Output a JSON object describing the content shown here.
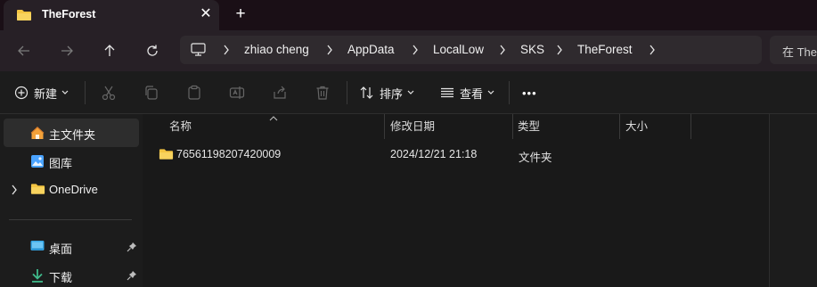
{
  "tab": {
    "title": "TheForest",
    "close_label": "✕",
    "new_tab_label": "+"
  },
  "nav": {
    "back_icon": "arrow-left-icon",
    "forward_icon": "arrow-right-icon",
    "up_icon": "arrow-up-icon",
    "refresh_icon": "refresh-icon"
  },
  "address": {
    "segments": [
      "zhiao cheng",
      "AppData",
      "LocalLow",
      "SKS",
      "TheForest"
    ]
  },
  "search": {
    "placeholder": "在 The"
  },
  "toolbar": {
    "new_label": "新建",
    "sort_label": "排序",
    "view_label": "查看",
    "more_label": "•••"
  },
  "sidebar": {
    "items": [
      {
        "label": "主文件夹",
        "icon": "home-icon"
      },
      {
        "label": "图库",
        "icon": "gallery-icon"
      },
      {
        "label": "OneDrive",
        "icon": "folder-icon"
      },
      {
        "label": "桌面",
        "icon": "desktop-icon"
      },
      {
        "label": "下载",
        "icon": "download-icon"
      }
    ]
  },
  "columns": {
    "name": "名称",
    "modified": "修改日期",
    "type": "类型",
    "size": "大小"
  },
  "files": [
    {
      "name": "76561198207420009",
      "modified": "2024/12/21 21:18",
      "type": "文件夹",
      "size": ""
    }
  ],
  "colors": {
    "folder": "#f4c542",
    "accent": "#4aa3ff"
  }
}
